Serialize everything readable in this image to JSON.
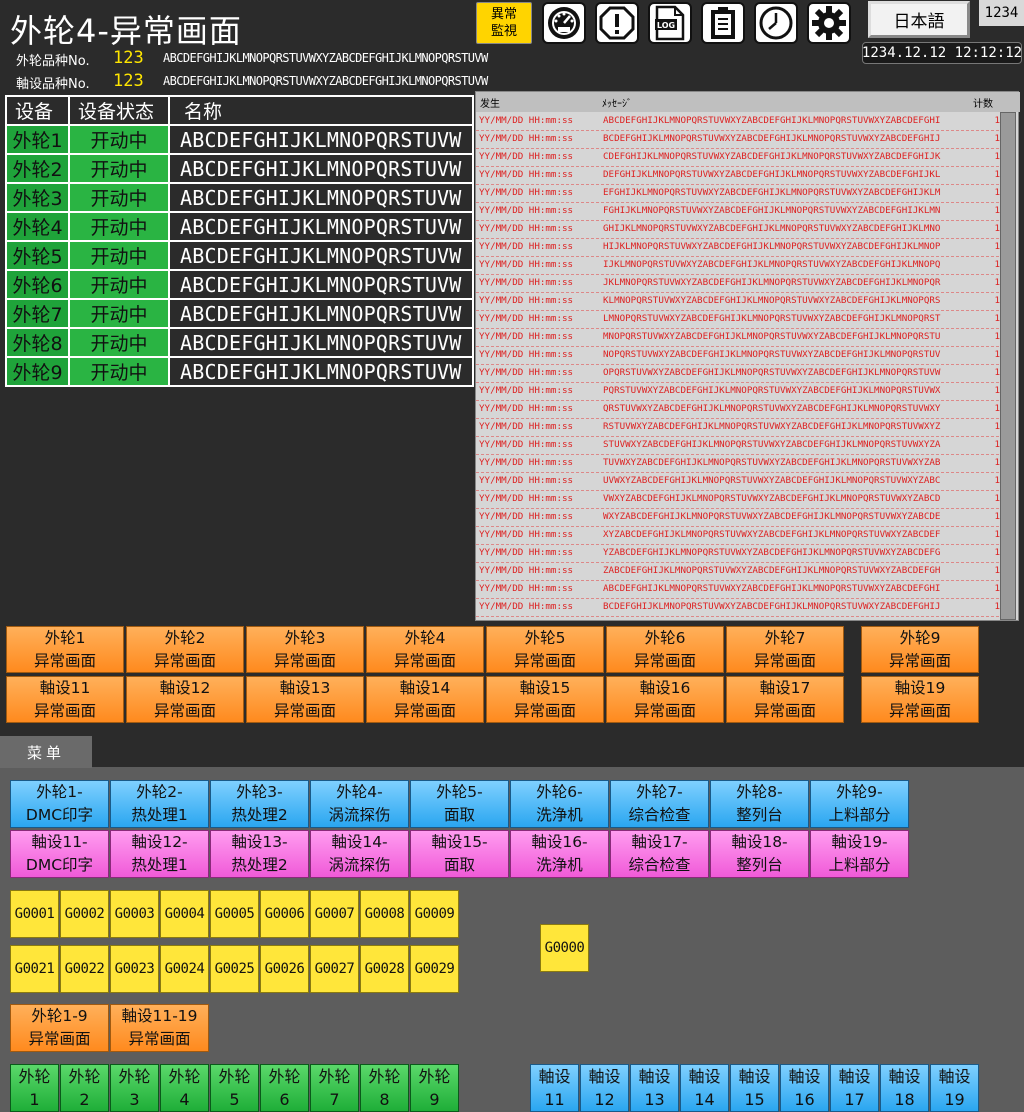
{
  "header": {
    "title": "外轮4-异常画面",
    "outer_product_label": "外轮品种No.",
    "outer_product_no": "123",
    "outer_product_name": "ABCDEFGHIJKLMNOPQRSTUVWXYZABCDEFGHIJKLMNOPQRSTUVW",
    "shaft_product_label": "軸设品种No.",
    "shaft_product_no": "123",
    "shaft_product_name": "ABCDEFGHIJKLMNOPQRSTUVWXYZABCDEFGHIJKLMNOPQRSTUVW",
    "abnormal_monitor_label": "異常\n監視",
    "log_label": "LOG",
    "language_label": "日本語",
    "counter": "1234",
    "datetime": "1234.12.12  12:12:12",
    "icons": [
      "gauge-icon",
      "warning-icon",
      "log-icon",
      "clipboard-icon",
      "clock-icon",
      "gear-icon"
    ]
  },
  "equipment_table": {
    "headers": [
      "设备",
      "设备状态",
      "名称"
    ],
    "rows": [
      {
        "device": "外轮1",
        "status": "开动中",
        "name": "ABCDEFGHIJKLMNOPQRSTUVW"
      },
      {
        "device": "外轮2",
        "status": "开动中",
        "name": "ABCDEFGHIJKLMNOPQRSTUVW"
      },
      {
        "device": "外轮3",
        "status": "开动中",
        "name": "ABCDEFGHIJKLMNOPQRSTUVW"
      },
      {
        "device": "外轮4",
        "status": "开动中",
        "name": "ABCDEFGHIJKLMNOPQRSTUVW"
      },
      {
        "device": "外轮5",
        "status": "开动中",
        "name": "ABCDEFGHIJKLMNOPQRSTUVW"
      },
      {
        "device": "外轮6",
        "status": "开动中",
        "name": "ABCDEFGHIJKLMNOPQRSTUVW"
      },
      {
        "device": "外轮7",
        "status": "开动中",
        "name": "ABCDEFGHIJKLMNOPQRSTUVW"
      },
      {
        "device": "外轮8",
        "status": "开动中",
        "name": "ABCDEFGHIJKLMNOPQRSTUVW"
      },
      {
        "device": "外轮9",
        "status": "开动中",
        "name": "ABCDEFGHIJKLMNOPQRSTUVW"
      }
    ]
  },
  "alarm_list": {
    "headers": {
      "occurred": "发生",
      "message": "ﾒｯｾｰｼﾞ",
      "count": "计数"
    },
    "rows": [
      {
        "time": "YY/MM/DD HH:mm:ss",
        "message": "ABCDEFGHIJKLMNOPQRSTUVWXYZABCDEFGHIJKLMNOPQRSTUVWXYZABCDEFGHI",
        "count": "1"
      },
      {
        "time": "YY/MM/DD HH:mm:ss",
        "message": "BCDEFGHIJKLMNOPQRSTUVWXYZABCDEFGHIJKLMNOPQRSTUVWXYZABCDEFGHIJ",
        "count": "1"
      },
      {
        "time": "YY/MM/DD HH:mm:ss",
        "message": "CDEFGHIJKLMNOPQRSTUVWXYZABCDEFGHIJKLMNOPQRSTUVWXYZABCDEFGHIJK",
        "count": "1"
      },
      {
        "time": "YY/MM/DD HH:mm:ss",
        "message": "DEFGHIJKLMNOPQRSTUVWXYZABCDEFGHIJKLMNOPQRSTUVWXYZABCDEFGHIJKL",
        "count": "1"
      },
      {
        "time": "YY/MM/DD HH:mm:ss",
        "message": "EFGHIJKLMNOPQRSTUVWXYZABCDEFGHIJKLMNOPQRSTUVWXYZABCDEFGHIJKLM",
        "count": "1"
      },
      {
        "time": "YY/MM/DD HH:mm:ss",
        "message": "FGHIJKLMNOPQRSTUVWXYZABCDEFGHIJKLMNOPQRSTUVWXYZABCDEFGHIJKLMN",
        "count": "1"
      },
      {
        "time": "YY/MM/DD HH:mm:ss",
        "message": "GHIJKLMNOPQRSTUVWXYZABCDEFGHIJKLMNOPQRSTUVWXYZABCDEFGHIJKLMNO",
        "count": "1"
      },
      {
        "time": "YY/MM/DD HH:mm:ss",
        "message": "HIJKLMNOPQRSTUVWXYZABCDEFGHIJKLMNOPQRSTUVWXYZABCDEFGHIJKLMNOP",
        "count": "1"
      },
      {
        "time": "YY/MM/DD HH:mm:ss",
        "message": "IJKLMNOPQRSTUVWXYZABCDEFGHIJKLMNOPQRSTUVWXYZABCDEFGHIJKLMNOPQ",
        "count": "1"
      },
      {
        "time": "YY/MM/DD HH:mm:ss",
        "message": "JKLMNOPQRSTUVWXYZABCDEFGHIJKLMNOPQRSTUVWXYZABCDEFGHIJKLMNOPQR",
        "count": "1"
      },
      {
        "time": "YY/MM/DD HH:mm:ss",
        "message": "KLMNOPQRSTUVWXYZABCDEFGHIJKLMNOPQRSTUVWXYZABCDEFGHIJKLMNOPQRS",
        "count": "1"
      },
      {
        "time": "YY/MM/DD HH:mm:ss",
        "message": "LMNOPQRSTUVWXYZABCDEFGHIJKLMNOPQRSTUVWXYZABCDEFGHIJKLMNOPQRST",
        "count": "1"
      },
      {
        "time": "YY/MM/DD HH:mm:ss",
        "message": "MNOPQRSTUVWXYZABCDEFGHIJKLMNOPQRSTUVWXYZABCDEFGHIJKLMNOPQRSTU",
        "count": "1"
      },
      {
        "time": "YY/MM/DD HH:mm:ss",
        "message": "NOPQRSTUVWXYZABCDEFGHIJKLMNOPQRSTUVWXYZABCDEFGHIJKLMNOPQRSTUV",
        "count": "1"
      },
      {
        "time": "YY/MM/DD HH:mm:ss",
        "message": "OPQRSTUVWXYZABCDEFGHIJKLMNOPQRSTUVWXYZABCDEFGHIJKLMNOPQRSTUVW",
        "count": "1"
      },
      {
        "time": "YY/MM/DD HH:mm:ss",
        "message": "PQRSTUVWXYZABCDEFGHIJKLMNOPQRSTUVWXYZABCDEFGHIJKLMNOPQRSTUVWX",
        "count": "1"
      },
      {
        "time": "YY/MM/DD HH:mm:ss",
        "message": "QRSTUVWXYZABCDEFGHIJKLMNOPQRSTUVWXYZABCDEFGHIJKLMNOPQRSTUVWXY",
        "count": "1"
      },
      {
        "time": "YY/MM/DD HH:mm:ss",
        "message": "RSTUVWXYZABCDEFGHIJKLMNOPQRSTUVWXYZABCDEFGHIJKLMNOPQRSTUVWXYZ",
        "count": "1"
      },
      {
        "time": "YY/MM/DD HH:mm:ss",
        "message": "STUVWXYZABCDEFGHIJKLMNOPQRSTUVWXYZABCDEFGHIJKLMNOPQRSTUVWXYZA",
        "count": "1"
      },
      {
        "time": "YY/MM/DD HH:mm:ss",
        "message": "TUVWXYZABCDEFGHIJKLMNOPQRSTUVWXYZABCDEFGHIJKLMNOPQRSTUVWXYZAB",
        "count": "1"
      },
      {
        "time": "YY/MM/DD HH:mm:ss",
        "message": "UVWXYZABCDEFGHIJKLMNOPQRSTUVWXYZABCDEFGHIJKLMNOPQRSTUVWXYZABC",
        "count": "1"
      },
      {
        "time": "YY/MM/DD HH:mm:ss",
        "message": "VWXYZABCDEFGHIJKLMNOPQRSTUVWXYZABCDEFGHIJKLMNOPQRSTUVWXYZABCD",
        "count": "1"
      },
      {
        "time": "YY/MM/DD HH:mm:ss",
        "message": "WXYZABCDEFGHIJKLMNOPQRSTUVWXYZABCDEFGHIJKLMNOPQRSTUVWXYZABCDE",
        "count": "1"
      },
      {
        "time": "YY/MM/DD HH:mm:ss",
        "message": "XYZABCDEFGHIJKLMNOPQRSTUVWXYZABCDEFGHIJKLMNOPQRSTUVWXYZABCDEF",
        "count": "1"
      },
      {
        "time": "YY/MM/DD HH:mm:ss",
        "message": "YZABCDEFGHIJKLMNOPQRSTUVWXYZABCDEFGHIJKLMNOPQRSTUVWXYZABCDEFG",
        "count": "1"
      },
      {
        "time": "YY/MM/DD HH:mm:ss",
        "message": "ZABCDEFGHIJKLMNOPQRSTUVWXYZABCDEFGHIJKLMNOPQRSTUVWXYZABCDEFGH",
        "count": "1"
      },
      {
        "time": "YY/MM/DD HH:mm:ss",
        "message": "ABCDEFGHIJKLMNOPQRSTUVWXYZABCDEFGHIJKLMNOPQRSTUVWXYZABCDEFGHI",
        "count": "1"
      },
      {
        "time": "YY/MM/DD HH:mm:ss",
        "message": "BCDEFGHIJKLMNOPQRSTUVWXYZABCDEFGHIJKLMNOPQRSTUVWXYZABCDEFGHIJ",
        "count": "1"
      }
    ]
  },
  "abnormal_screen_buttons": {
    "row1": [
      {
        "line1": "外轮1",
        "line2": "异常画面"
      },
      {
        "line1": "外轮2",
        "line2": "异常画面"
      },
      {
        "line1": "外轮3",
        "line2": "异常画面"
      },
      {
        "line1": "外轮4",
        "line2": "异常画面"
      },
      {
        "line1": "外轮5",
        "line2": "异常画面"
      },
      {
        "line1": "外轮6",
        "line2": "异常画面"
      },
      {
        "line1": "外轮7",
        "line2": "异常画面"
      },
      {
        "line1": "外轮9",
        "line2": "异常画面"
      }
    ],
    "row2": [
      {
        "line1": "軸设11",
        "line2": "异常画面"
      },
      {
        "line1": "軸设12",
        "line2": "异常画面"
      },
      {
        "line1": "軸设13",
        "line2": "异常画面"
      },
      {
        "line1": "軸设14",
        "line2": "异常画面"
      },
      {
        "line1": "軸设15",
        "line2": "异常画面"
      },
      {
        "line1": "軸设16",
        "line2": "异常画面"
      },
      {
        "line1": "軸设17",
        "line2": "异常画面"
      },
      {
        "line1": "軸设19",
        "line2": "异常画面"
      }
    ]
  },
  "menu": {
    "tab_label": "菜单",
    "outer_process_buttons": [
      {
        "line1": "外轮1-",
        "line2": "DMC印字"
      },
      {
        "line1": "外轮2-",
        "line2": "热处理1"
      },
      {
        "line1": "外轮3-",
        "line2": "热处理2"
      },
      {
        "line1": "外轮4-",
        "line2": "涡流探伤"
      },
      {
        "line1": "外轮5-",
        "line2": "面取"
      },
      {
        "line1": "外轮6-",
        "line2": "洗浄机"
      },
      {
        "line1": "外轮7-",
        "line2": "综合检查"
      },
      {
        "line1": "外轮8-",
        "line2": "整列台"
      },
      {
        "line1": "外轮9-",
        "line2": "上料部分"
      }
    ],
    "shaft_process_buttons": [
      {
        "line1": "軸设11-",
        "line2": "DMC印字"
      },
      {
        "line1": "軸设12-",
        "line2": "热处理1"
      },
      {
        "line1": "軸设13-",
        "line2": "热处理2"
      },
      {
        "line1": "軸设14-",
        "line2": "涡流探伤"
      },
      {
        "line1": "軸设15-",
        "line2": "面取"
      },
      {
        "line1": "軸设16-",
        "line2": "洗浄机"
      },
      {
        "line1": "軸设17-",
        "line2": "综合检查"
      },
      {
        "line1": "軸设18-",
        "line2": "整列台"
      },
      {
        "line1": "軸设19-",
        "line2": "上料部分"
      }
    ],
    "g_buttons_row1": [
      "G0001",
      "G0002",
      "G0003",
      "G0004",
      "G0005",
      "G0006",
      "G0007",
      "G0008",
      "G0009"
    ],
    "g_buttons_row2": [
      "G0021",
      "G0022",
      "G0023",
      "G0024",
      "G0025",
      "G0026",
      "G0027",
      "G0028",
      "G0029"
    ],
    "g_button_single": "G0000",
    "range_buttons": [
      {
        "line1": "外轮1-9",
        "line2": "异常画面"
      },
      {
        "line1": "軸设11-19",
        "line2": "异常画面"
      }
    ],
    "outer_unit_buttons": [
      {
        "line1": "外轮",
        "line2": "1"
      },
      {
        "line1": "外轮",
        "line2": "2"
      },
      {
        "line1": "外轮",
        "line2": "3"
      },
      {
        "line1": "外轮",
        "line2": "4"
      },
      {
        "line1": "外轮",
        "line2": "5"
      },
      {
        "line1": "外轮",
        "line2": "6"
      },
      {
        "line1": "外轮",
        "line2": "7"
      },
      {
        "line1": "外轮",
        "line2": "8"
      },
      {
        "line1": "外轮",
        "line2": "9"
      }
    ],
    "shaft_unit_buttons": [
      {
        "line1": "軸设",
        "line2": "11"
      },
      {
        "line1": "軸设",
        "line2": "12"
      },
      {
        "line1": "軸设",
        "line2": "13"
      },
      {
        "line1": "軸设",
        "line2": "14"
      },
      {
        "line1": "軸设",
        "line2": "15"
      },
      {
        "line1": "軸设",
        "line2": "16"
      },
      {
        "line1": "軸设",
        "line2": "17"
      },
      {
        "line1": "軸设",
        "line2": "18"
      },
      {
        "line1": "軸设",
        "line2": "19"
      }
    ]
  }
}
